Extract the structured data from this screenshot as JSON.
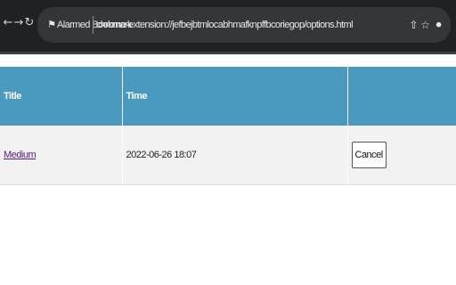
{
  "browser": {
    "back_icon": "arrow-left-icon",
    "forward_icon": "arrow-right-icon",
    "reload_icon": "reload-icon",
    "extension_icon": "bookmark-icon",
    "extension_name": "Alarmed Bookmark",
    "url": "chrome-extension://jefbejbtmlocabhmafknpffbcoriegop/options.html",
    "share_icon": "share-icon",
    "star_icon": "star-icon",
    "extensions_icon": "puzzle-icon"
  },
  "table": {
    "headers": {
      "title": "Title",
      "time": "Time",
      "action": ""
    },
    "rows": [
      {
        "title": "Medium",
        "time": "2022-06-26 18:07",
        "action_label": "Cancel"
      }
    ]
  },
  "colors": {
    "header_bg": "#4a9ac0",
    "row_bg": "#f2f2f2",
    "link": "#551a8b",
    "browser_bg": "#202124"
  }
}
